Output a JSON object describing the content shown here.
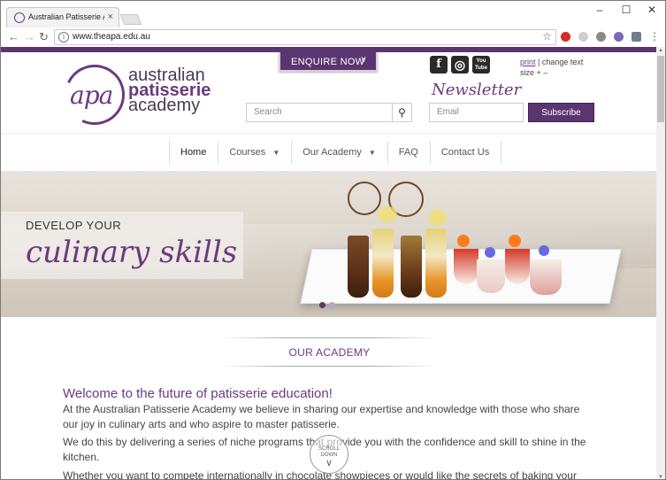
{
  "browser": {
    "tab_title": "Australian Patisserie Aca",
    "tab_close": "×",
    "window_minimize": "–",
    "window_maximize": "☐",
    "window_close": "✕",
    "url": "www.theapa.edu.au",
    "back_icon": "←",
    "forward_icon": "→",
    "reload_icon": "↻",
    "star_icon": "☆",
    "menu_icon": "⋮"
  },
  "header": {
    "enquire_label": "ENQUIRE NOW",
    "enquire_chevron": "∨",
    "logo_mark": "apa",
    "logo_line1": "australian",
    "logo_line2": "patisserie",
    "logo_line3": "academy",
    "social": [
      "f",
      "◎",
      "You Tube"
    ],
    "print_label": "print",
    "change_text_label": " | change text size + –",
    "search_placeholder": "Search",
    "search_icon": "⚲",
    "newsletter_title": "Newsletter",
    "email_placeholder": "Email",
    "subscribe_label": "Subscribe"
  },
  "nav": {
    "items": [
      {
        "label": "Home",
        "has_dropdown": false
      },
      {
        "label": "Courses",
        "has_dropdown": true
      },
      {
        "label": "Our Academy",
        "has_dropdown": true
      },
      {
        "label": "FAQ",
        "has_dropdown": false
      },
      {
        "label": "Contact Us",
        "has_dropdown": false
      }
    ],
    "caret": "▼"
  },
  "hero": {
    "caption_line1": "DEVELOP YOUR",
    "caption_line2": "culinary skills",
    "slide_count": 2,
    "active_slide": 1
  },
  "section": {
    "title": "OUR ACADEMY",
    "heading": "Welcome to the future of patisserie education!",
    "para1": "At the Australian Patisserie Academy we believe in sharing our expertise and knowledge with those who share our joy in culinary arts and who aspire to master patisserie.",
    "para2": "We do this by delivering a series of niche programs that provide you with the confidence and skill to shine in the kitchen.",
    "para3": "Whether you want to compete internationally in chocolate showpieces or would like the secrets of baking your own",
    "scroll_label_1": "SCROLL",
    "scroll_label_2": "DOWN",
    "scroll_chevron": "∨"
  },
  "colors": {
    "brand_purple": "#5b3570",
    "accent_purple": "#6b3a7d"
  }
}
